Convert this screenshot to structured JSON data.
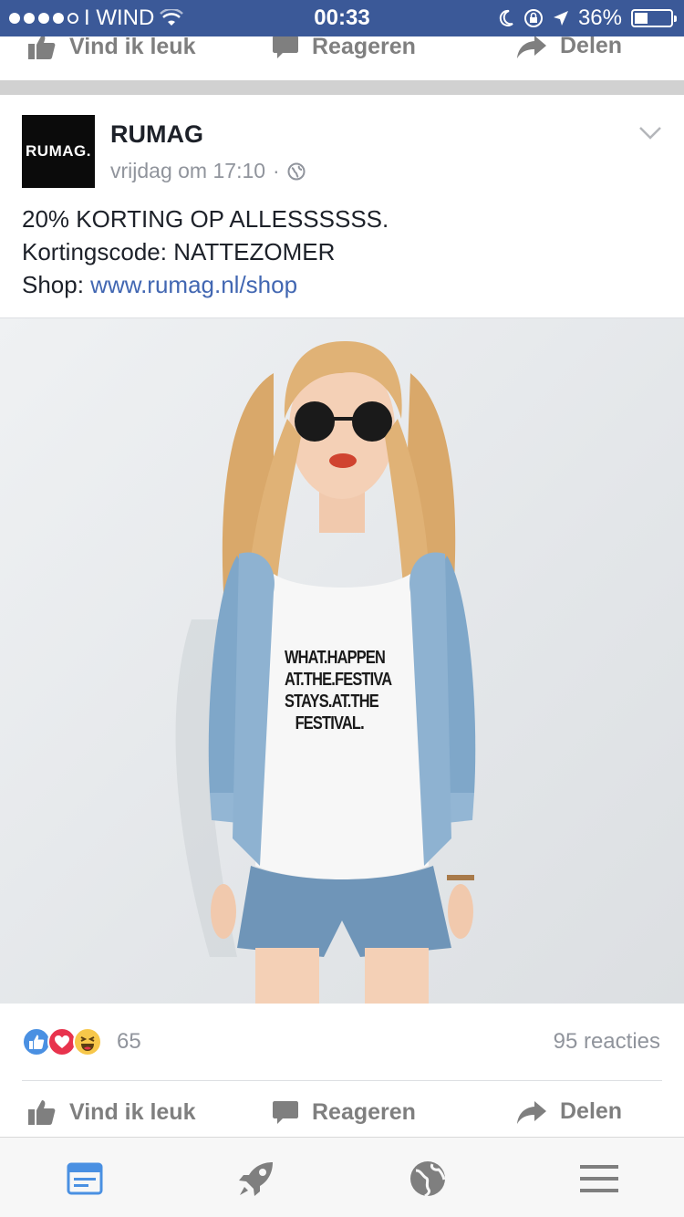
{
  "status_bar": {
    "carrier": "I WIND",
    "time": "00:33",
    "battery_percent": "36%",
    "battery_level": 0.36
  },
  "prev_post_actions": {
    "like": "Vind ik leuk",
    "comment": "Reageren",
    "share": "Delen"
  },
  "post": {
    "page_name": "RUMAG",
    "avatar_text": "RUMAG.",
    "timestamp": "vrijdag om 17:10",
    "separator": "·",
    "text_line1": "20% KORTING OP ALLESSSSSS.",
    "text_line2": "Kortingscode: NATTEZOMER",
    "text_line3_prefix": "Shop: ",
    "text_line3_link": "www.rumag.nl/shop",
    "photo": {
      "shirt_text_1": "WHAT.HAPPEN",
      "shirt_text_2": "AT.THE.FESTIVA",
      "shirt_text_3": "STAYS.AT.THE",
      "shirt_text_4": "FESTIVAL."
    },
    "reaction_icons": [
      "like-reaction-icon",
      "love-reaction-icon",
      "haha-reaction-icon"
    ],
    "reaction_count": "65",
    "comment_count": "95 reacties",
    "actions": {
      "like": "Vind ik leuk",
      "comment": "Reageren",
      "share": "Delen"
    }
  },
  "bottom_nav": [
    "news-feed-icon",
    "rocket-icon",
    "globe-icon",
    "menu-icon"
  ],
  "colors": {
    "brand": "#3b5998",
    "link": "#4267b2",
    "like": "#4a90e2",
    "love": "#e8334d",
    "haha": "#f7c74a",
    "nav_active": "#4a90e2",
    "nav_inactive": "#7f7f7f"
  }
}
